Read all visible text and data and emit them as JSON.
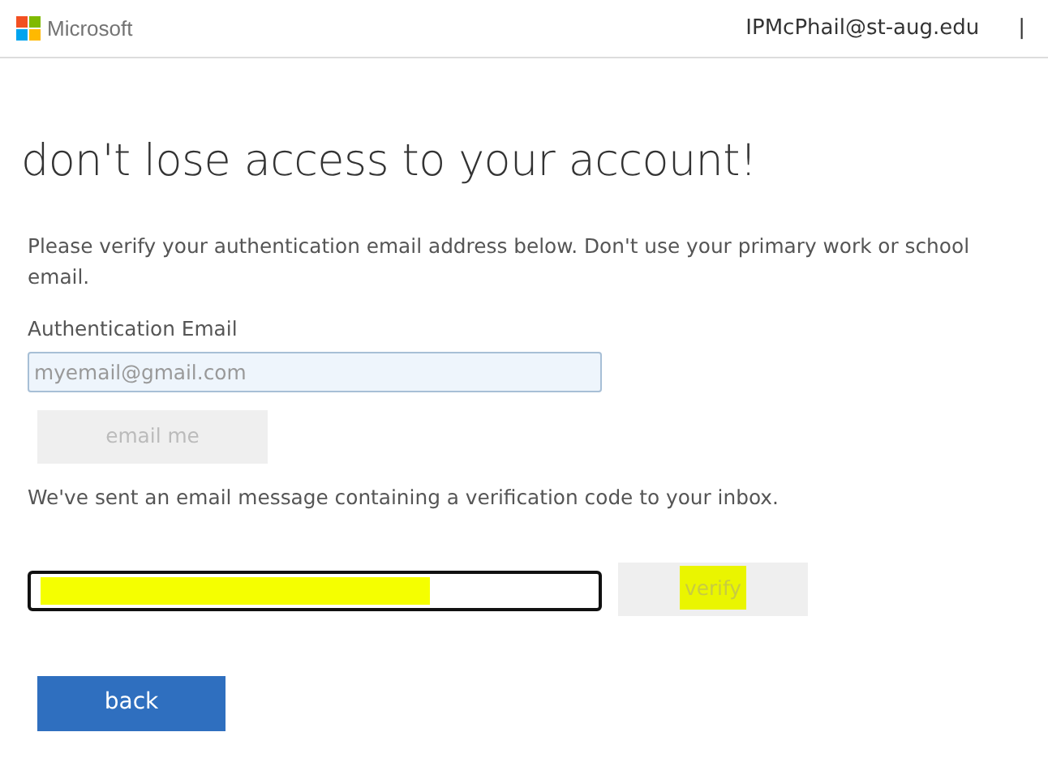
{
  "header": {
    "brand": "Microsoft",
    "account": "IPMcPhail@st-aug.edu",
    "separator": "|"
  },
  "title": "don't lose access to your account!",
  "instructions": "Please verify your authentication email address below. Don't use your primary work or school email.",
  "email_field": {
    "label": "Authentication Email",
    "placeholder": "myemail@gmail.com"
  },
  "email_button": {
    "label": "email me",
    "disabled": true
  },
  "sent_message": "We've sent an email message containing a verification code to your inbox.",
  "code_field": {
    "highlighted": true
  },
  "verify_button": {
    "label": "verify",
    "disabled": true,
    "highlighted": true
  },
  "back_button": {
    "label": "back"
  }
}
